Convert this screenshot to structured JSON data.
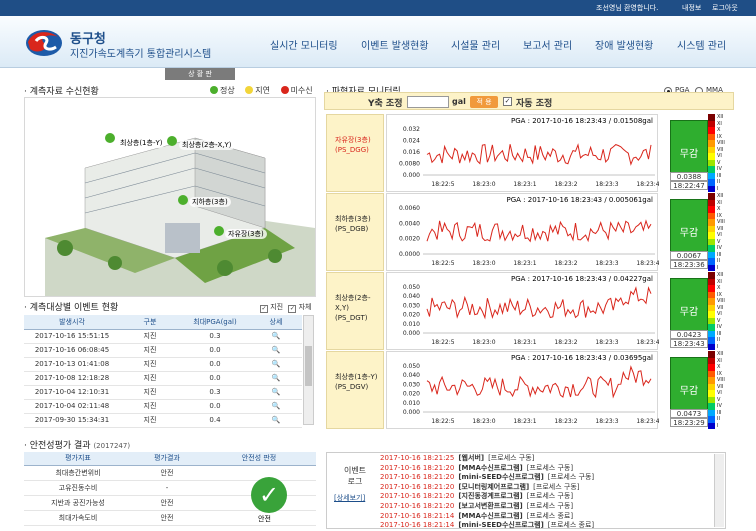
{
  "topbar": {
    "welcome": "조선영님 환영합니다.",
    "myinfo": "내정보",
    "logout": "로그아웃"
  },
  "brand": {
    "name": "동구청",
    "subtitle": "지진가속도계측기 통합관리시스템"
  },
  "nav": [
    "실시간 모니터링",
    "이벤트 발생현황",
    "시설물 관리",
    "보고서 관리",
    "장애 발생현황",
    "시스템 관리"
  ],
  "status_tab": "상 황 판",
  "reception": {
    "title": "계측자료 수신현황",
    "legend": [
      {
        "label": "정상",
        "color": "#4caf2c"
      },
      {
        "label": "지연",
        "color": "#f2d53a"
      },
      {
        "label": "미수신",
        "color": "#d9261c"
      }
    ],
    "callouts": [
      "최상층(1층-Y)",
      "최상층(2층-X,Y)",
      "지하층(3층)",
      "자유장(3층)"
    ]
  },
  "events": {
    "title": "계측대상별 이벤트 현황",
    "filters": [
      "지진",
      "자체"
    ],
    "headers": [
      "발생시각",
      "구분",
      "최대PGA(gal)",
      "상세"
    ],
    "rows": [
      [
        "2017-10-16 15:51:15",
        "지진",
        "0.3"
      ],
      [
        "2017-10-16 06:08:45",
        "지진",
        "0.0"
      ],
      [
        "2017-10-13 01:41:08",
        "지진",
        "0.0"
      ],
      [
        "2017-10-08 12:18:28",
        "지진",
        "0.0"
      ],
      [
        "2017-10-04 12:10:31",
        "지진",
        "0.3"
      ],
      [
        "2017-10-04 02:11:48",
        "지진",
        "0.0"
      ],
      [
        "2017-09-30 15:34:31",
        "지진",
        "0.4"
      ]
    ]
  },
  "safety": {
    "title": "안전성평가 결과",
    "year": "(2017247)",
    "headers": [
      "평가지표",
      "평가결과",
      "안전성 판정"
    ],
    "rows": [
      [
        "최대층간변위비",
        "안전"
      ],
      [
        "고유진동수비",
        "-"
      ],
      [
        "지반과 공진가능성",
        "안전"
      ],
      [
        "최대가속도비",
        "안전"
      ]
    ],
    "verdict": "안전"
  },
  "waveform": {
    "title": "파형자료 모니터링",
    "yscale": "Y축 조정",
    "unit": "gal",
    "apply": "적 용",
    "auto": "자동 조정",
    "radio": [
      "PGA",
      "MMA"
    ],
    "xticks": [
      "18:22:5",
      "18:23:0",
      "18:23:1",
      "18:23:2",
      "18:23:3",
      "18:23:4"
    ],
    "panels": [
      {
        "name": "자유장(3층)",
        "code": "(PS_DGG)",
        "pga": "PGA : 2017-10-16 18:23:43 / 0.01508gal",
        "yticks": [
          "0.032",
          "0.024",
          "0.016",
          "0.0080",
          "0.000"
        ],
        "ymax": 0.032,
        "status": "무감",
        "value": "0.0388",
        "time": "18:22:47",
        "red": true
      },
      {
        "name": "최하층(3층)",
        "code": "(PS_DGB)",
        "pga": "PGA : 2017-10-16 18:23:43 / 0.005061gal",
        "yticks": [
          "0.0060",
          "0.0040",
          "0.0020",
          "0.0000"
        ],
        "ymax": 0.007,
        "status": "무감",
        "value": "0.0067",
        "time": "18:23:36",
        "red": false
      },
      {
        "name": "최상층(2층-X,Y)",
        "code": "(PS_DGT)",
        "pga": "PGA : 2017-10-16 18:23:43 / 0.04227gal",
        "yticks": [
          "0.050",
          "0.040",
          "0.030",
          "0.020",
          "0.010",
          "0.000"
        ],
        "ymax": 0.05,
        "status": "무감",
        "value": "0.0423",
        "time": "18:23:43",
        "red": false
      },
      {
        "name": "최상층(1층-Y)",
        "code": "(PS_DGV)",
        "pga": "PGA : 2017-10-16 18:23:43 / 0.03695gal",
        "yticks": [
          "0.050",
          "0.040",
          "0.030",
          "0.020",
          "0.010",
          "0.000"
        ],
        "ymax": 0.05,
        "status": "무감",
        "value": "0.0473",
        "time": "18:23:29",
        "red": false
      }
    ]
  },
  "intensity_scale": [
    "XII",
    "XI",
    "X",
    "IX",
    "VIII",
    "VII",
    "VI",
    "V",
    "IV",
    "III",
    "II",
    "I"
  ],
  "eventlog": {
    "label": "이벤트\n로그",
    "link": "[상세보기]",
    "lines": [
      [
        "2017-10-16 18:21:25",
        "[웹서버]",
        "[프로세스 구동]"
      ],
      [
        "2017-10-16 18:21:20",
        "[MMA수신프로그램]",
        "[프로세스 구동]"
      ],
      [
        "2017-10-16 18:21:20",
        "[mini-SEED수신프로그램]",
        "[프로세스 구동]"
      ],
      [
        "2017-10-16 18:21:20",
        "[모니터링제어프로그램]",
        "[프로세스 구동]"
      ],
      [
        "2017-10-16 18:21:20",
        "[지진동경계프로그램]",
        "[프로세스 구동]"
      ],
      [
        "2017-10-16 18:21:20",
        "[보고서변환프로그램]",
        "[프로세스 구동]"
      ],
      [
        "2017-10-16 18:21:14",
        "[MMA수신프로그램]",
        "[프로세스 종료]"
      ],
      [
        "2017-10-16 18:21:14",
        "[mini-SEED수신프로그램]",
        "[프로세스 종료]"
      ]
    ]
  }
}
